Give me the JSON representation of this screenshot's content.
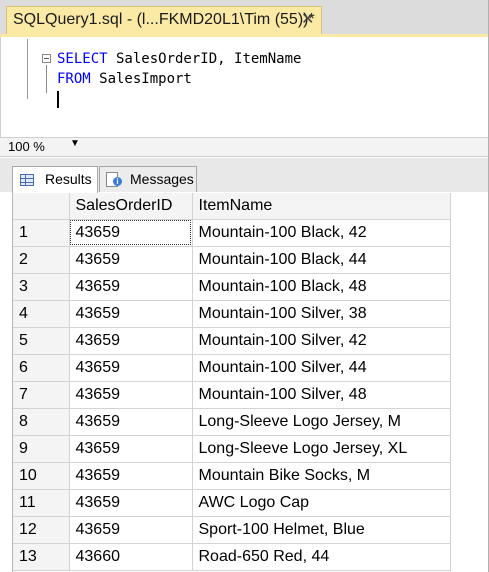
{
  "document_tab": {
    "title": "SQLQuery1.sql - (l...FKMD20L1\\Tim (55))*",
    "close_glyph": "✕"
  },
  "editor": {
    "line1": {
      "keyword": "SELECT",
      "rest": " SalesOrderID, ItemName"
    },
    "line2": {
      "keyword": "FROM",
      "rest": " SalesImport"
    }
  },
  "zoom": {
    "value": "100 %",
    "arrow": "▼"
  },
  "result_tabs": [
    {
      "label": "Results",
      "active": true,
      "icon": "results-grid-icon"
    },
    {
      "label": "Messages",
      "active": false,
      "icon": "messages-icon"
    }
  ],
  "grid": {
    "columns": [
      "SalesOrderID",
      "ItemName"
    ],
    "rows": [
      [
        "1",
        "43659",
        "Mountain-100 Black, 42"
      ],
      [
        "2",
        "43659",
        "Mountain-100 Black, 44"
      ],
      [
        "3",
        "43659",
        "Mountain-100 Black, 48"
      ],
      [
        "4",
        "43659",
        "Mountain-100 Silver, 38"
      ],
      [
        "5",
        "43659",
        "Mountain-100 Silver, 42"
      ],
      [
        "6",
        "43659",
        "Mountain-100 Silver, 44"
      ],
      [
        "7",
        "43659",
        "Mountain-100 Silver, 48"
      ],
      [
        "8",
        "43659",
        "Long-Sleeve Logo Jersey, M"
      ],
      [
        "9",
        "43659",
        "Long-Sleeve Logo Jersey, XL"
      ],
      [
        "10",
        "43659",
        "Mountain Bike Socks, M"
      ],
      [
        "11",
        "43659",
        "AWC Logo Cap"
      ],
      [
        "12",
        "43659",
        "Sport-100 Helmet, Blue"
      ],
      [
        "13",
        "43660",
        "Road-650 Red, 44"
      ]
    ]
  }
}
